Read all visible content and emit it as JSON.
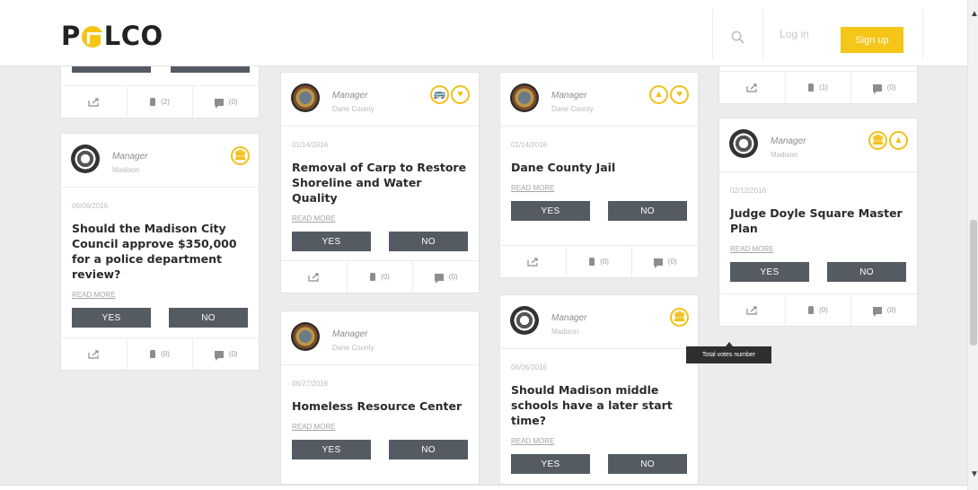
{
  "header": {
    "logo_text_left": "P",
    "logo_text_right": "LCO",
    "login_label": "Log in",
    "signup_label": "Sign up"
  },
  "common": {
    "yes_label": "YES",
    "no_label": "NO",
    "read_more": "READ MORE"
  },
  "tooltip": "Total votes number",
  "cards": [
    {
      "footer_votes": "(2)",
      "footer_comments": "(0)"
    },
    {
      "role": "Manager",
      "place": "Madison",
      "badges": [
        "🏛"
      ],
      "date": "06/06/2016",
      "title": "Should the Madison City Council approve $350,000 for a police department review?",
      "footer_votes": "(0)",
      "footer_comments": "(0)"
    },
    {
      "role": "Manager",
      "place": "Dane County",
      "badges": [
        "🚌",
        "♥"
      ],
      "date": "01/14/2016",
      "title": "Removal of Carp to Restore Shoreline and Water Quality",
      "footer_votes": "(0)",
      "footer_comments": "(0)"
    },
    {
      "role": "Manager",
      "place": "Dane County",
      "date": "06/27/2016",
      "title": "Homeless Resource Center"
    },
    {
      "role": "Manager",
      "place": "Dane County",
      "badges": [
        "▲",
        "♥"
      ],
      "date": "01/14/2016",
      "title": "Dane County Jail",
      "footer_votes": "(0)",
      "footer_comments": "(0)"
    },
    {
      "role": "Manager",
      "place": "Madison",
      "badges": [
        "🏛"
      ],
      "date": "06/06/2016",
      "title": "Should Madison middle schools have a later start time?"
    },
    {
      "footer_votes": "(1)",
      "footer_comments": "(0)"
    },
    {
      "role": "Manager",
      "place": "Madison",
      "badges": [
        "🏛",
        "▲"
      ],
      "date": "02/12/2016",
      "title": "Judge Doyle Square Master Plan",
      "footer_votes": "(0)",
      "footer_comments": "(0)"
    }
  ]
}
